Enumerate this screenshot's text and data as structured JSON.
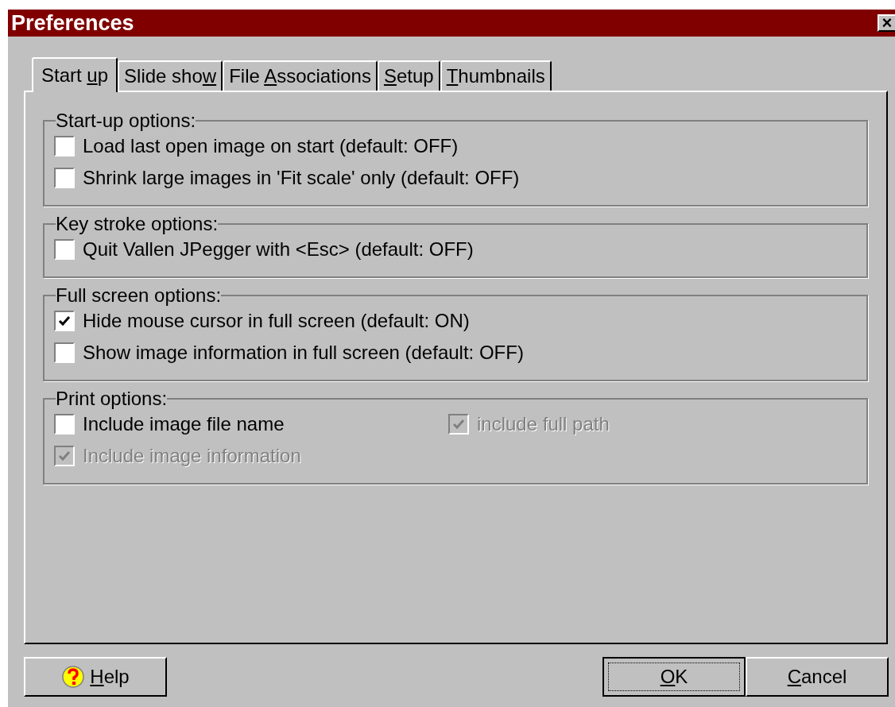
{
  "window": {
    "title": "Preferences",
    "close": "×"
  },
  "tabs": [
    {
      "before": "Start ",
      "key": "u",
      "after": "p",
      "selected": true
    },
    {
      "before": "Slide sho",
      "key": "w",
      "selected": false
    },
    {
      "before": "File ",
      "key": "A",
      "after": "ssociations",
      "selected": false
    },
    {
      "key": "S",
      "after": "etup",
      "selected": false
    },
    {
      "key": "T",
      "after": "humbnails",
      "selected": false
    }
  ],
  "groups": [
    {
      "title": "Start-up options:",
      "kind": "list",
      "items": [
        {
          "label": "Load last open image on start (default: OFF)",
          "checked": false,
          "disabled": false
        },
        {
          "label": "Shrink large images in 'Fit scale' only (default: OFF)",
          "checked": false,
          "disabled": false
        }
      ]
    },
    {
      "title": "Key stroke options:",
      "kind": "list",
      "items": [
        {
          "label": "Quit Vallen JPegger with <Esc> (default: OFF)",
          "checked": false,
          "disabled": false
        }
      ]
    },
    {
      "title": "Full screen options:",
      "kind": "list",
      "items": [
        {
          "label": "Hide mouse cursor in full screen (default: ON)",
          "checked": true,
          "disabled": false
        },
        {
          "label": "Show image information in full screen (default: OFF)",
          "checked": false,
          "disabled": false
        }
      ]
    },
    {
      "title": "Print options:",
      "kind": "grid",
      "items": [
        {
          "label": "Include image file name",
          "checked": false,
          "disabled": false
        },
        {
          "label": "include full path",
          "checked": true,
          "disabled": true
        },
        {
          "label": "Include image information",
          "checked": true,
          "disabled": true
        }
      ]
    }
  ],
  "buttons": [
    {
      "key": "H",
      "after": "elp",
      "kind": "help",
      "focused": false
    },
    {
      "key": "O",
      "after": "K",
      "kind": "plain",
      "focused": true
    },
    {
      "key": "C",
      "after": "ancel",
      "kind": "plain",
      "focused": false
    }
  ]
}
